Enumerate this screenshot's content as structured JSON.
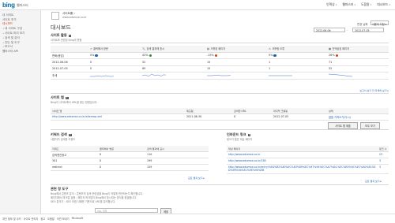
{
  "header": {
    "logo": "bing",
    "logo_sub": "웹마스터",
    "nav": [
      {
        "label": "인덱싱",
        "arrow": "▾"
      },
      {
        "label": "웹마스터",
        "arrow": "▾"
      },
      {
        "label": "도움말",
        "arrow": "▾"
      },
      {
        "label": "대시보드",
        "arrow": "▾"
      }
    ]
  },
  "sidebar": {
    "items": [
      {
        "label": "내 사이트",
        "active": false,
        "indent": false
      },
      {
        "label": "사이트 추가",
        "active": false,
        "indent": false
      },
      {
        "label": "대시보드",
        "active": true,
        "indent": false
      },
      {
        "label": "내 사이트 구성",
        "active": false,
        "indent": true
      },
      {
        "label": "사이트 미리 보기",
        "active": false,
        "indent": true
      },
      {
        "label": "검색 및 분석",
        "active": false,
        "indent": true
      },
      {
        "label": "진단 및 도구",
        "active": false,
        "indent": true
      },
      {
        "label": "보고서",
        "active": false,
        "indent": true
      },
      {
        "label": "웹마스터 API",
        "active": false,
        "indent": false
      }
    ]
  },
  "site": {
    "name": "사이트를",
    "name_arrow": "▾",
    "url": "www.adsense.co.kr"
  },
  "page": {
    "title": "대시보드",
    "date_label": "변경 날짜",
    "date_select": "사용자 지정",
    "date_from": "2012-06-06",
    "date_dash": "-",
    "date_to": "2012-07-05"
  },
  "summary": {
    "title": "사이트 활동",
    "desc": "사이트와 관련된 Bing의 활동",
    "columns": [
      "",
      "클릭해서 방문",
      "검색 결과에 표시",
      "크롤된 페이지",
      "크롤링 오류",
      "인덱싱된 페이지"
    ],
    "change_row": {
      "label": "변화(증감)",
      "values": [
        "0%",
        "43%",
        "-15%",
        "0%",
        "26%"
      ]
    },
    "rows": [
      {
        "label": "2012-06-06",
        "values": [
          "0",
          "52",
          "15",
          "1",
          "71"
        ]
      },
      {
        "label": "2012-07-05",
        "values": [
          "0",
          "89",
          "15",
          "1",
          "52"
        ]
      },
      {
        "label": "추세",
        "values": [
          "",
          "",
          "",
          "",
          ""
        ]
      }
    ],
    "more_link": "보고서 보기 더 자세히 보기 ▸",
    "sparkline_color": "#3b6fd6"
  },
  "sitemaps": {
    "title": "사이트 맵",
    "badge": "1",
    "desc": "Bing이 사이트에서 URL을 찾는 방법입니다.",
    "columns": [
      "사이트 맵",
      "",
      "제출됨",
      "검색한 URL",
      "마지막 크롤링",
      "상태"
    ],
    "rows": [
      {
        "url": "http://www.adsense.co.kr/sitemap.xml",
        "submitted": "2011-06-30",
        "urls": "0",
        "crawled": "2012-07-03",
        "status": "없음 가져오기(다시)"
      }
    ],
    "submit_button": "사이트 맵 제출",
    "all_button": "모두 보기"
  },
  "keywords": {
    "title": "키워드 검색",
    "badge": "3",
    "desc": "사용자가 검색한 키워드",
    "columns": [
      "키워드",
      "클릭해서 방문",
      "검색 결과에 표시"
    ],
    "rows": [
      {
        "keyword": "검색엔진광고",
        "clicks": "0",
        "impressions": "110"
      },
      {
        "keyword": "301",
        "clicks": "0",
        "impressions": "199"
      },
      {
        "keyword": "redirect",
        "clicks": "0",
        "impressions": "159"
      }
    ],
    "more_link": "모든 결과 보기 ▸"
  },
  "inbound": {
    "title": "인바운드 링크",
    "badge": "3",
    "desc": "링크가 많은 대상 페이지",
    "columns": [
      "대상 페이지",
      "링크 수"
    ],
    "rows": [
      {
        "url": "http://www.adsense.co.kr",
        "count": "23"
      },
      {
        "url": "http://www.adsense.co.kr/158",
        "count": "3"
      },
      {
        "url": "http://www.adsense.co.kr/entry/%EA%B2%80%EC%83%89%EC%97%94%EC%A7%84-%EC%B5%9C%EC%A0%81%ED%99%94%EC%9E%90%EB",
        "count": "3"
      }
    ],
    "more_link": "모든 결과 보기 ▸"
  },
  "tools": {
    "title": "관련 정 도구",
    "lines": [
      "Bing에서 콘텐츠 분석 : 콘텐츠의 검색 관련성을 Bing이 어떻게 판단하는지 확인합니다.",
      "페이지에서 마크업 검증 : 페이지 마크업이 Bing에서 표시되는 방식을 점검합니다.",
      "SEO 분석기 : SEO 모범 사례를 기준으로 URL을 분석합니다."
    ],
    "url_placeholder": "URL 입력",
    "go_button": "제출"
  },
  "footer": {
    "links": [
      "개인 정보 및 쿠키",
      "사이트 관리자",
      "광고",
      "도움말",
      "의견 보내기",
      "Microsoft"
    ]
  }
}
